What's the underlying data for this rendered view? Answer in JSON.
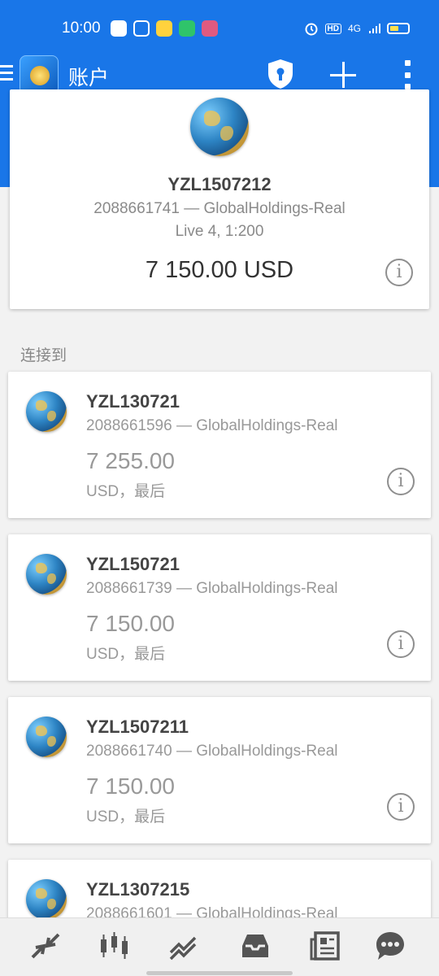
{
  "status_bar": {
    "time": "10:00",
    "network": "4G",
    "hd": "HD"
  },
  "app_bar": {
    "title": "账户"
  },
  "current_account": {
    "name": "YZL1507212",
    "server": "2088661741 — GlobalHoldings-Real",
    "type": "Live 4, 1:200",
    "balance": "7 150.00 USD"
  },
  "section_label": "连接到",
  "accounts": [
    {
      "name": "YZL130721",
      "server": "2088661596 — GlobalHoldings-Real",
      "balance": "7 255.00",
      "status": "USD，最后"
    },
    {
      "name": "YZL150721",
      "server": "2088661739 — GlobalHoldings-Real",
      "balance": "7 150.00",
      "status": "USD，最后"
    },
    {
      "name": "YZL1507211",
      "server": "2088661740 — GlobalHoldings-Real",
      "balance": "7 150.00",
      "status": "USD，最后"
    },
    {
      "name": "YZL1307215",
      "server": "2088661601 — GlobalHoldings-Real"
    }
  ],
  "bottom_nav": [
    "quotes-icon",
    "chart-icon",
    "trade-icon",
    "history-icon",
    "news-icon",
    "chat-icon"
  ],
  "colors": {
    "primary": "#1976e8",
    "nav_icon": "#555555"
  }
}
